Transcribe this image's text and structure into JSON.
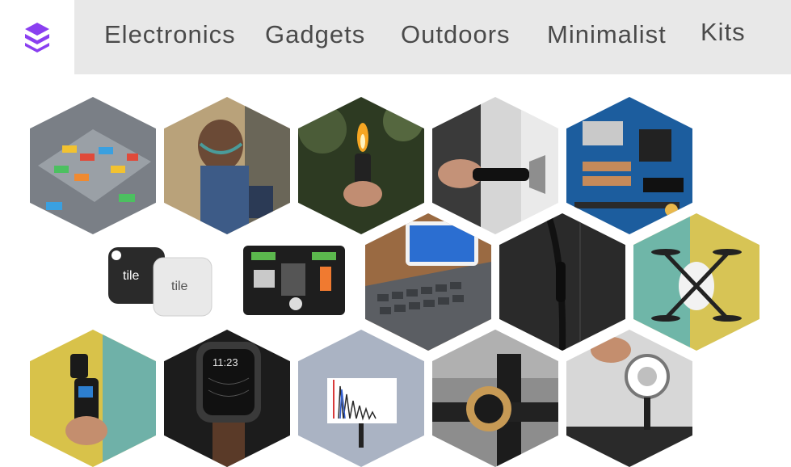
{
  "brand": {
    "logo_icon": "stacked-layers-icon",
    "accent": "#8a3ff0"
  },
  "nav": {
    "items": [
      {
        "label": "Electronics"
      },
      {
        "label": "Gadgets"
      },
      {
        "label": "Outdoors"
      },
      {
        "label": "Minimalist"
      },
      {
        "label": "Kits"
      }
    ]
  },
  "tiles": {
    "row1": [
      "lego-building-plate",
      "bone-conduction-headphones",
      "keychain-lighter",
      "keychain-bottle-opener",
      "arduino-board"
    ],
    "row2": [
      "tile-trackers",
      "cable-organizer-grid",
      "folding-keyboard",
      "braided-cable",
      "mini-drone"
    ],
    "row3": [
      "pocket-gimbal-camera",
      "smartwatch",
      "mini-chart-display",
      "bike-bell",
      "ring-light-phone-mount"
    ],
    "tile_brand_label": "tile",
    "watch_time": "11:23"
  }
}
